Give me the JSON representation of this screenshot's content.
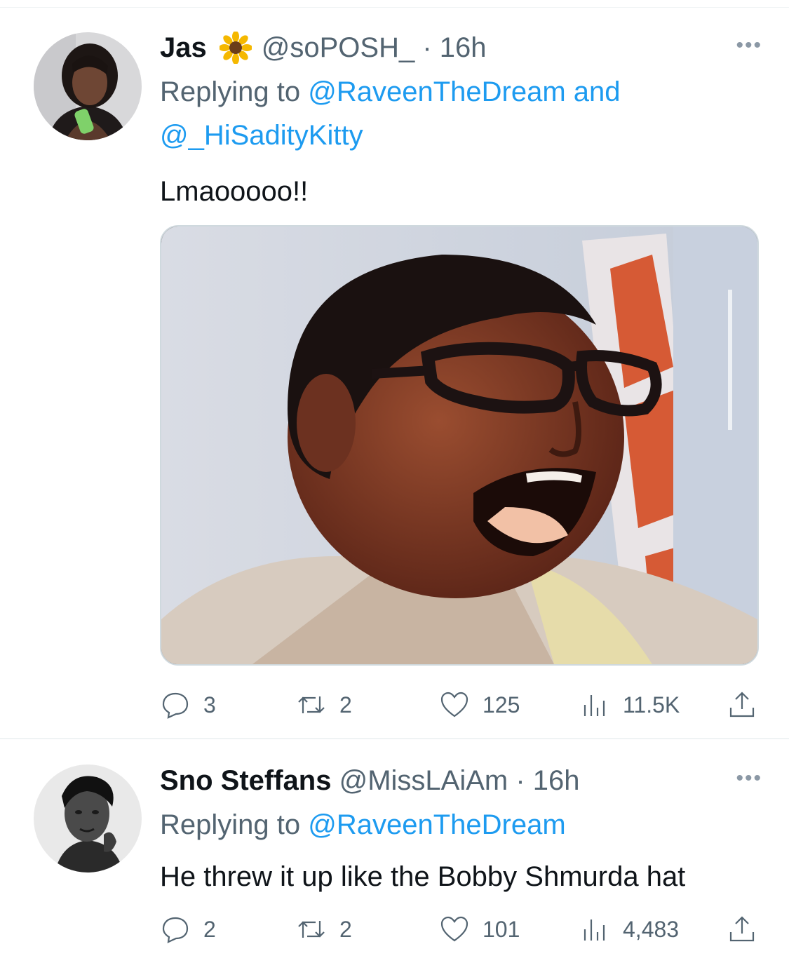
{
  "tweets": [
    {
      "name": "Jas",
      "name_emoji": "sunflower",
      "handle": "@soPOSH_",
      "time": "16h",
      "replying_prefix": "Replying to",
      "replying_to": [
        "@RaveenTheDream",
        "@_HiSadityKitty"
      ],
      "replying_joiner": "and",
      "text": "Lmaooooo!!",
      "has_media": true,
      "actions": {
        "replies": "3",
        "retweets": "2",
        "likes": "125",
        "views": "11.5K"
      }
    },
    {
      "name": "Sno Steffans",
      "handle": "@MissLAiAm",
      "time": "16h",
      "replying_prefix": "Replying to",
      "replying_to": [
        "@RaveenTheDream"
      ],
      "text": "He threw it up like the Bobby Shmurda hat",
      "has_media": false,
      "actions": {
        "replies": "2",
        "retweets": "2",
        "likes": "101",
        "views": "4,483"
      }
    }
  ],
  "colors": {
    "link": "#1d9bf0",
    "muted": "#536471",
    "text": "#0f1419"
  },
  "icons": [
    "more-icon",
    "reply-icon",
    "retweet-icon",
    "like-icon",
    "views-icon",
    "share-icon",
    "sunflower-emoji"
  ]
}
